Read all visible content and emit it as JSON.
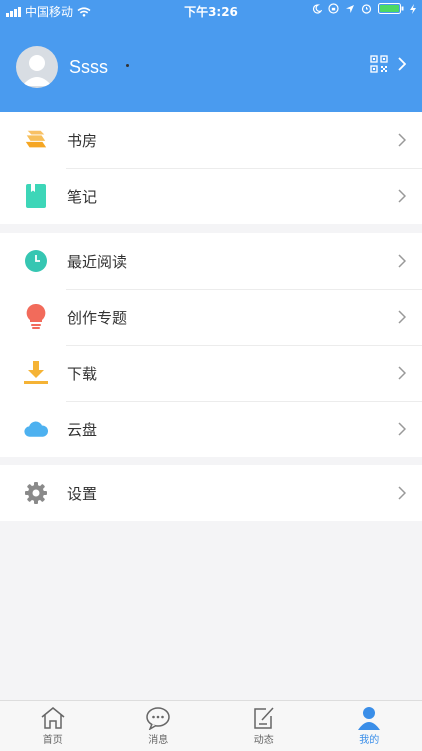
{
  "status_bar": {
    "carrier": "中国移动",
    "time": "下午3:26"
  },
  "profile": {
    "username": "Ssss"
  },
  "menu_groups": [
    {
      "items": [
        {
          "key": "study",
          "label": "书房",
          "icon": "books-icon",
          "color": "#f5a623"
        },
        {
          "key": "notes",
          "label": "笔记",
          "icon": "notebook-icon",
          "color": "#3dd6b8"
        }
      ]
    },
    {
      "items": [
        {
          "key": "recent",
          "label": "最近阅读",
          "icon": "clock-icon",
          "color": "#36c6b2"
        },
        {
          "key": "topics",
          "label": "创作专题",
          "icon": "lightbulb-icon",
          "color": "#f26b5b"
        },
        {
          "key": "download",
          "label": "下载",
          "icon": "download-icon",
          "color": "#f5b335"
        },
        {
          "key": "cloud",
          "label": "云盘",
          "icon": "cloud-icon",
          "color": "#4db1f0"
        }
      ]
    },
    {
      "items": [
        {
          "key": "settings",
          "label": "设置",
          "icon": "gear-icon",
          "color": "#8a8a8a"
        }
      ]
    }
  ],
  "tab_bar": {
    "tabs": [
      {
        "label": "首页",
        "icon": "home-icon"
      },
      {
        "label": "消息",
        "icon": "chat-icon"
      },
      {
        "label": "动态",
        "icon": "edit-icon"
      },
      {
        "label": "我的",
        "icon": "person-icon",
        "active": true
      }
    ]
  },
  "colors": {
    "header": "#4a9bef",
    "active_tab": "#3a8ee8",
    "background": "#f4f4f6"
  }
}
